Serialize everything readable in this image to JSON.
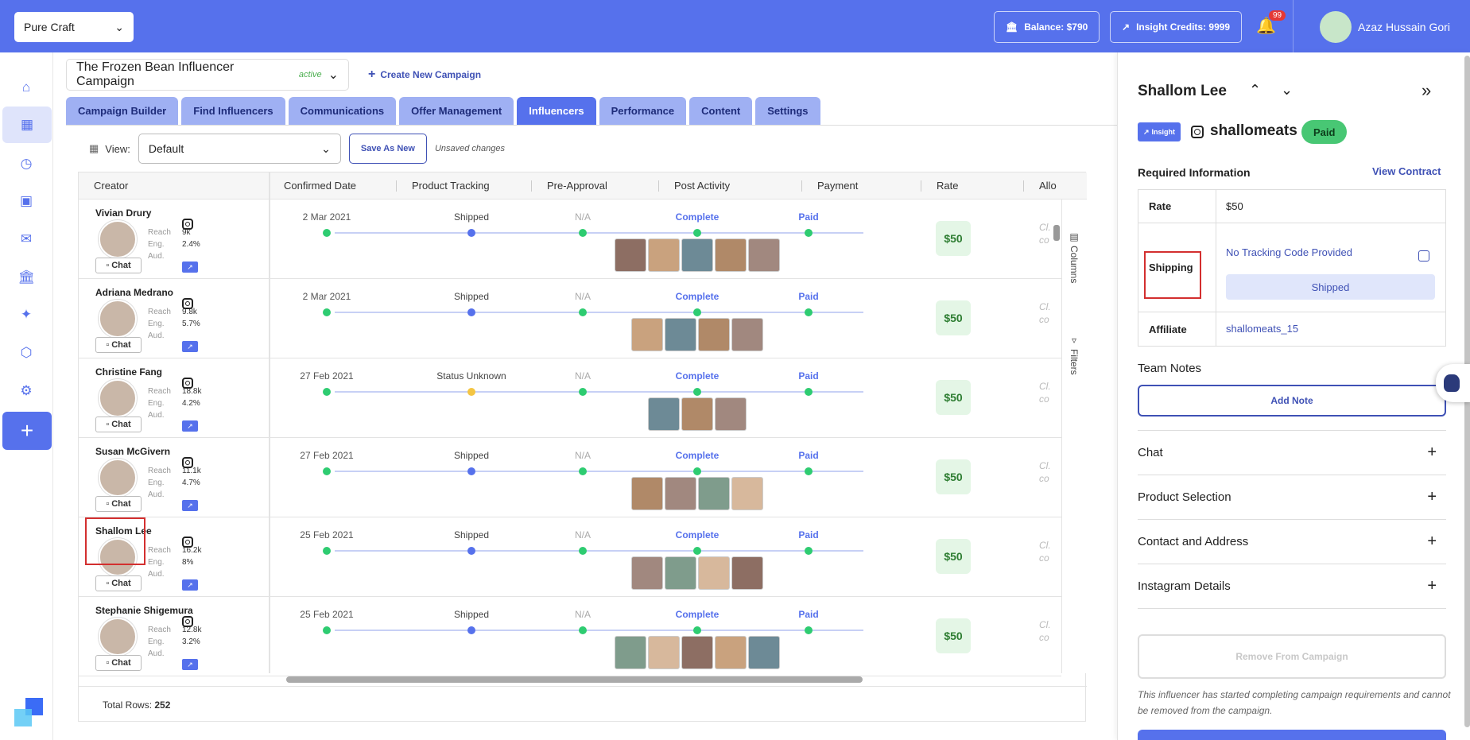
{
  "topbar": {
    "brand": "Pure Craft",
    "balance": "Balance: $790",
    "credits": "Insight Credits: 9999",
    "notifications": "99",
    "user_name": "Azaz Hussain Gori"
  },
  "nav": {
    "icons": [
      "home-icon",
      "dashboard-icon",
      "analytics-icon",
      "media-icon",
      "messages-icon",
      "bank-icon",
      "sparkle-icon",
      "shield-icon",
      "settings-icon"
    ],
    "add": "+"
  },
  "campaign": {
    "name": "The Frozen Bean Influencer Campaign",
    "status": "active",
    "create_label": "Create New Campaign"
  },
  "tabs": [
    "Campaign Builder",
    "Find Influencers",
    "Communications",
    "Offer Management",
    "Influencers",
    "Performance",
    "Content",
    "Settings"
  ],
  "active_tab": "Influencers",
  "toolbar": {
    "view_label": "View:",
    "view_value": "Default",
    "save_as_new": "Save As New",
    "unsaved": "Unsaved changes"
  },
  "table": {
    "columns": [
      "Creator",
      "Confirmed Date",
      "Product Tracking",
      "Pre-Approval",
      "Post Activity",
      "Payment",
      "Rate",
      "Allo"
    ],
    "stat_labels": [
      "Reach",
      "Eng.",
      "Aud."
    ],
    "chat_label": "Chat",
    "side_columns": "Columns",
    "side_filters": "Filters",
    "total_rows_label": "Total Rows:",
    "total_rows": "252",
    "rows": [
      {
        "name": "Vivian Drury",
        "reach": "9k",
        "eng": "2.4%",
        "date": "2 Mar 2021",
        "tracking": "Shipped",
        "tracking_status": "b",
        "preapproval": "N/A",
        "post": "Complete",
        "payment": "Paid",
        "rate": "$50",
        "allow": "Cl.",
        "allow2": "co",
        "thumbs": 5
      },
      {
        "name": "Adriana Medrano",
        "reach": "9.8k",
        "eng": "5.7%",
        "date": "2 Mar 2021",
        "tracking": "Shipped",
        "tracking_status": "b",
        "preapproval": "N/A",
        "post": "Complete",
        "payment": "Paid",
        "rate": "$50",
        "allow": "Cl.",
        "allow2": "co",
        "thumbs": 4
      },
      {
        "name": "Christine Fang",
        "reach": "18.8k",
        "eng": "4.2%",
        "date": "27 Feb 2021",
        "tracking": "Status Unknown",
        "tracking_status": "y",
        "preapproval": "N/A",
        "post": "Complete",
        "payment": "Paid",
        "rate": "$50",
        "allow": "Cl.",
        "allow2": "co",
        "thumbs": 3
      },
      {
        "name": "Susan McGivern",
        "reach": "11.1k",
        "eng": "4.7%",
        "date": "27 Feb 2021",
        "tracking": "Shipped",
        "tracking_status": "b",
        "preapproval": "N/A",
        "post": "Complete",
        "payment": "Paid",
        "rate": "$50",
        "allow": "Cl.",
        "allow2": "co",
        "thumbs": 4
      },
      {
        "name": "Shallom Lee",
        "reach": "16.2k",
        "eng": "8%",
        "date": "25 Feb 2021",
        "tracking": "Shipped",
        "tracking_status": "b",
        "preapproval": "N/A",
        "post": "Complete",
        "payment": "Paid",
        "rate": "$50",
        "allow": "Cl.",
        "allow2": "co",
        "thumbs": 4
      },
      {
        "name": "Stephanie Shigemura",
        "reach": "12.8k",
        "eng": "3.2%",
        "date": "25 Feb 2021",
        "tracking": "Shipped",
        "tracking_status": "b",
        "preapproval": "N/A",
        "post": "Complete",
        "payment": "Paid",
        "rate": "$50",
        "allow": "Cl.",
        "allow2": "co",
        "thumbs": 5
      }
    ]
  },
  "panel": {
    "name": "Shallom Lee",
    "insight_badge": "Insight",
    "handle": "shallomeats",
    "status": "Paid",
    "required_info": "Required Information",
    "view_contract": "View Contract",
    "rate_label": "Rate",
    "rate_value": "$50",
    "shipping_label": "Shipping",
    "tracking_text": "No Tracking Code Provided",
    "shipped_button": "Shipped",
    "affiliate_label": "Affiliate",
    "affiliate_value": "shallomeats_15",
    "team_notes": "Team Notes",
    "add_note": "Add Note",
    "sections": [
      "Chat",
      "Product Selection",
      "Contact and Address",
      "Instagram Details"
    ],
    "remove_label": "Remove From Campaign",
    "remove_note": "This influencer has started completing campaign requirements and cannot be removed from the campaign."
  },
  "colors": {
    "primary": "#5671ec",
    "tab_inactive": "#9fb0f3",
    "success": "#2ecc71",
    "paid_pill": "#48c774",
    "warning": "#f4c542",
    "highlight": "#d32f2f"
  }
}
